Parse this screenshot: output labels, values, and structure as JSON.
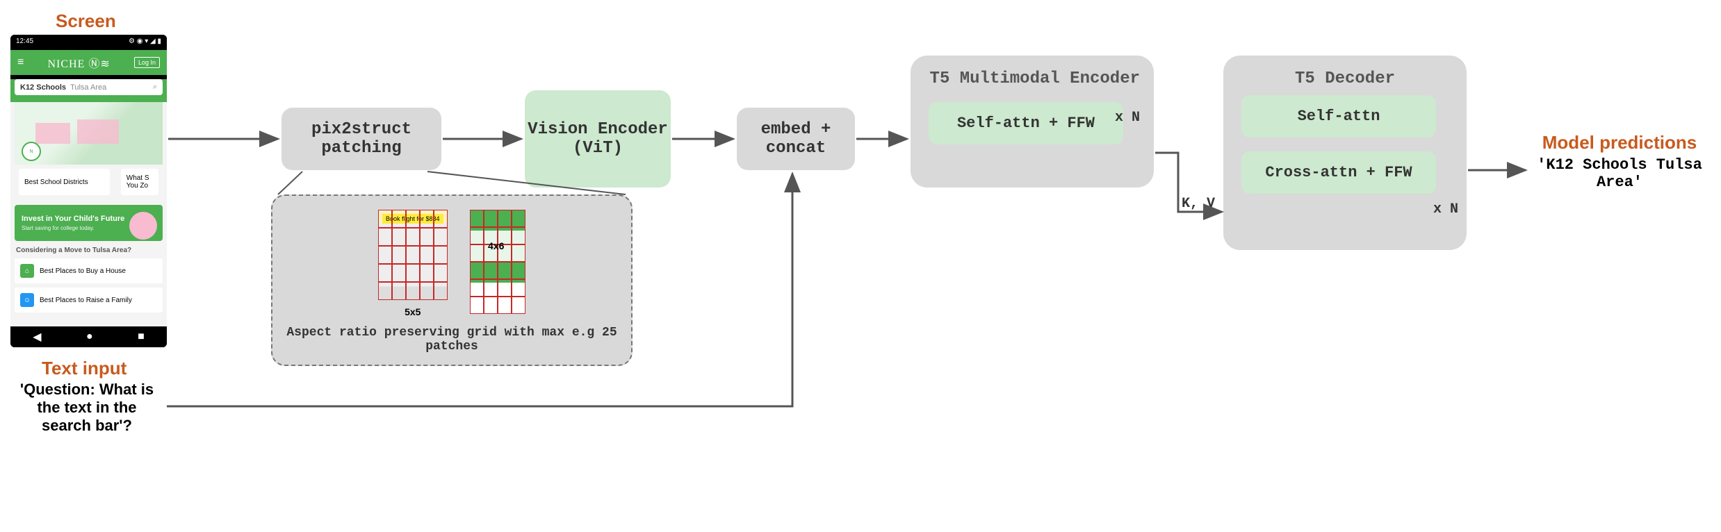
{
  "labels": {
    "screen": "Screen",
    "text_input": "Text input",
    "model_predictions": "Model predictions"
  },
  "text_input_value": "'Question: What is the text in the search bar'?",
  "model_output_value": "'K12 Schools Tulsa Area'",
  "blocks": {
    "pix2struct": "pix2struct patching",
    "vit": "Vision Encoder (ViT)",
    "embed": "embed + concat"
  },
  "encoder": {
    "title": "T5 Multimodal Encoder",
    "inner": "Self-attn + FFW",
    "xn": "x N"
  },
  "decoder": {
    "title": "T5 Decoder",
    "self_attn": "Self-attn",
    "cross_attn": "Cross-attn + FFW",
    "xn": "x N"
  },
  "kv_label": "K, V",
  "patch_detail": {
    "grid1": "5x5",
    "grid2": "4x6",
    "caption": "Aspect ratio preserving grid with max e.g 25 patches"
  },
  "phone": {
    "time": "12:45",
    "brand": "NICHE",
    "login": "Log In",
    "search_label": "K12 Schools",
    "search_value": "Tulsa Area",
    "card1": "Best School Districts",
    "card2": "What S\nYou Zo",
    "promo_title": "Invest in Your Child's Future",
    "promo_sub": "Start saving for college today.",
    "section_title": "Considering a Move to Tulsa Area?",
    "row1": "Best Places to Buy a House",
    "row2": "Best Places to Raise a Family",
    "thumb_text": "Book flight for $884"
  }
}
